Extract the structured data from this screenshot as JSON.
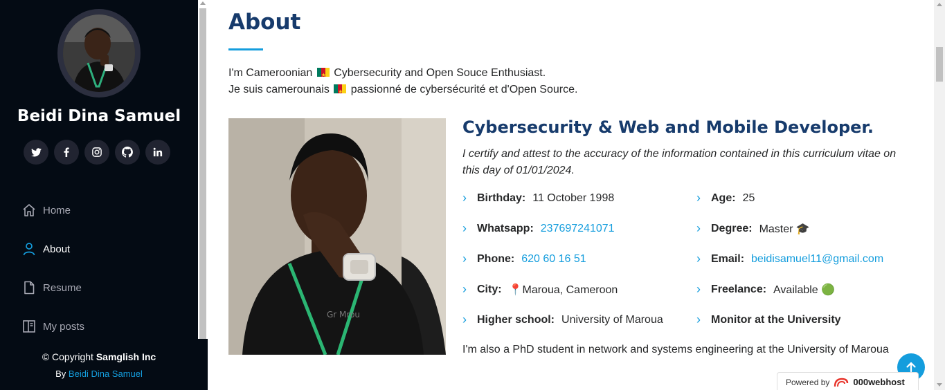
{
  "sidebar": {
    "profile_name": "Beidi Dina Samuel",
    "socials": [
      {
        "name": "twitter-icon",
        "glyph": "🐦"
      },
      {
        "name": "facebook-icon",
        "glyph": "f"
      },
      {
        "name": "instagram-icon",
        "glyph": "◎"
      },
      {
        "name": "github-icon",
        "glyph": "⌾"
      },
      {
        "name": "linkedin-icon",
        "glyph": "in"
      }
    ],
    "nav": [
      {
        "label": "Home",
        "icon": "home-icon",
        "active": false
      },
      {
        "label": "About",
        "icon": "person-icon",
        "active": true
      },
      {
        "label": "Resume",
        "icon": "file-icon",
        "active": false
      },
      {
        "label": "My posts",
        "icon": "layout-icon",
        "active": false
      }
    ],
    "copyright_prefix": "© Copyright ",
    "copyright_brand": "Samglish Inc",
    "credits_prefix": "By ",
    "credits_link": "Beidi Dina Samuel"
  },
  "about": {
    "title": "About",
    "intro_line1_a": "I'm Cameroonian ",
    "intro_line1_b": " Cybersecurity and Open Souce Enthusiast.",
    "intro_line2_a": "Je suis camerounais ",
    "intro_line2_b": " passionné de cybersécurité et d'Open Source.",
    "role": "Cybersecurity & Web and Mobile Developer.",
    "certify": "I certify and attest to the accuracy of the information contained in this curriculum vitae on this day of 01/01/2024.",
    "facts": {
      "birthday": {
        "label": "Birthday:",
        "value": "11 October 1998"
      },
      "age": {
        "label": "Age:",
        "value": "25"
      },
      "whatsapp": {
        "label": "Whatsapp:",
        "value": "237697241071"
      },
      "degree": {
        "label": "Degree:",
        "value": "Master 🎓"
      },
      "phone": {
        "label": "Phone:",
        "value": "620 60 16 51"
      },
      "email": {
        "label": "Email:",
        "value": "beidisamuel11@gmail.com"
      },
      "city": {
        "label": "City:",
        "value": "📍Maroua, Cameroon"
      },
      "freelance": {
        "label": "Freelance:",
        "value": "Available 🟢"
      },
      "school": {
        "label": "Higher school:",
        "value": "University of Maroua"
      },
      "monitor": {
        "label": "Monitor at the University",
        "value": ""
      }
    },
    "phd": "I'm also a PhD student in network and systems engineering at the University of Maroua"
  },
  "footer_badge": {
    "powered_by": "Powered by",
    "brand": "000webhost"
  },
  "colors": {
    "accent": "#149ddd",
    "heading": "#173b6c",
    "sidebar_bg": "#040b14"
  }
}
